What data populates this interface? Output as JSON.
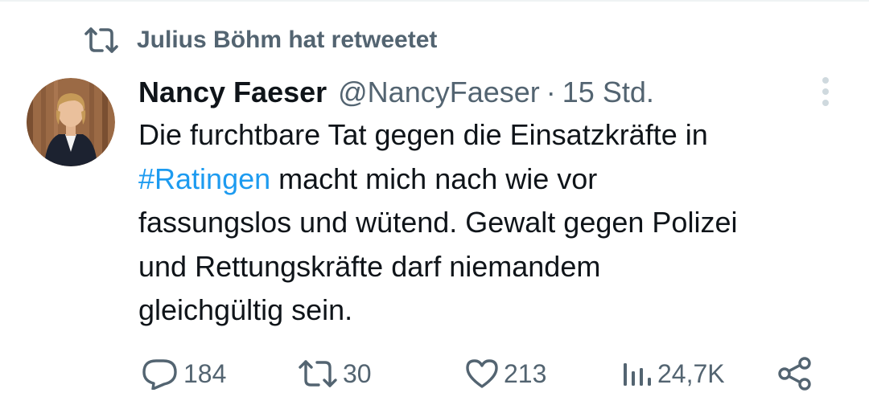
{
  "social_context": {
    "icon": "retweet-icon",
    "text": "Julius Böhm hat retweetet"
  },
  "tweet": {
    "author": {
      "name": "Nancy Faeser",
      "handle": "@NancyFaeser",
      "avatar": "profile-photo"
    },
    "separator": "·",
    "time": "15 Std.",
    "text": {
      "line1": "Die furchtbare Tat gegen die Einsatzkräfte in",
      "hashtag": "#Ratingen",
      "line2_rest": " macht mich nach wie vor",
      "line3": "fassungslos und wütend. Gewalt gegen Polizei",
      "line4": "und Rettungskräfte darf niemandem",
      "line5": "gleichgültig sein."
    }
  },
  "actions": {
    "replies": "184",
    "retweets": "30",
    "likes": "213",
    "views": "24,7K"
  },
  "colors": {
    "text": "#0f1419",
    "muted": "#536471",
    "link": "#1d9bf0",
    "more_dots": "#cfd9de"
  }
}
